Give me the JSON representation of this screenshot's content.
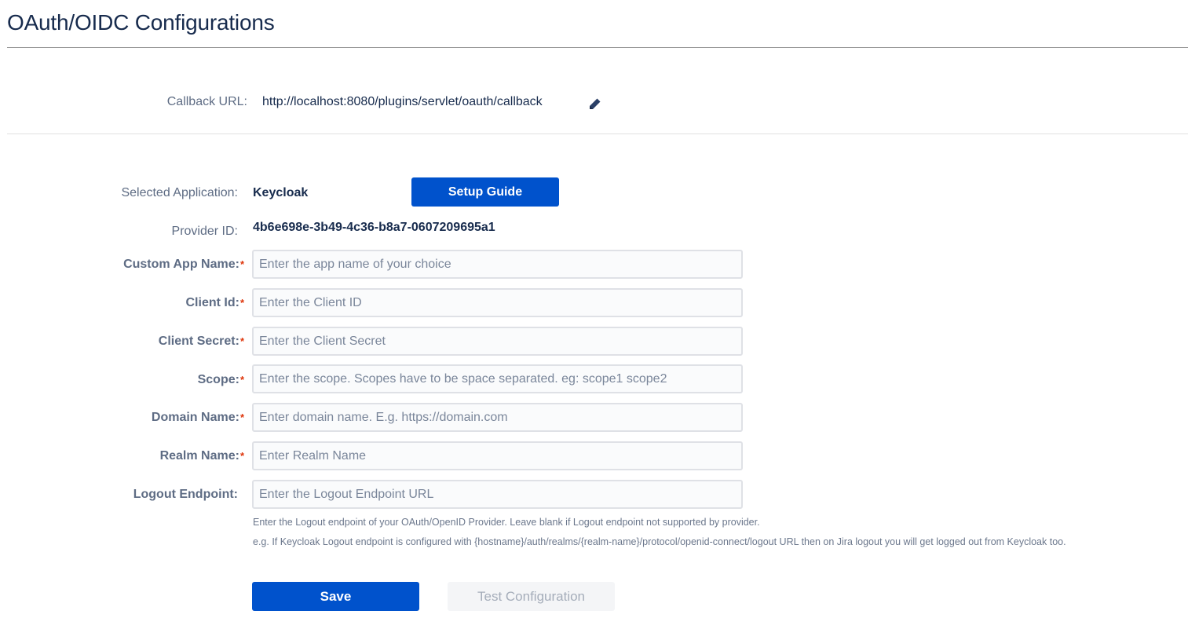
{
  "header": {
    "title": "OAuth/OIDC Configurations"
  },
  "callback": {
    "label": "Callback URL:",
    "url": "http://localhost:8080/plugins/servlet/oauth/callback",
    "edit_icon": "pencil-icon"
  },
  "application": {
    "selected_label": "Selected Application:",
    "selected_value": "Keycloak",
    "setup_guide_label": "Setup Guide",
    "provider_label": "Provider ID:",
    "provider_value": "4b6e698e-3b49-4c36-b8a7-0607209695a1"
  },
  "form": {
    "required_marker": "*",
    "fields": [
      {
        "label": "Custom App Name:",
        "required": true,
        "value": "",
        "placeholder": "Enter the app name of your choice"
      },
      {
        "label": "Client Id:",
        "required": true,
        "value": "",
        "placeholder": "Enter the Client ID"
      },
      {
        "label": "Client Secret:",
        "required": true,
        "value": "",
        "placeholder": "Enter the Client Secret"
      },
      {
        "label": "Scope:",
        "required": true,
        "value": "",
        "placeholder": "Enter the scope. Scopes have to be space separated. eg: scope1 scope2"
      },
      {
        "label": "Domain Name:",
        "required": true,
        "value": "",
        "placeholder": "Enter domain name. E.g. https://domain.com"
      },
      {
        "label": "Realm Name:",
        "required": true,
        "value": "",
        "placeholder": "Enter Realm Name"
      },
      {
        "label": "Logout Endpoint:",
        "required": false,
        "value": "",
        "placeholder": "Enter the Logout Endpoint URL"
      }
    ],
    "logout_help": [
      "Enter the Logout endpoint of your OAuth/OpenID Provider. Leave blank if Logout endpoint not supported by provider.",
      "e.g. If Keycloak Logout endpoint is configured with {hostname}/auth/realms/{realm-name}/protocol/openid-connect/logout URL then on Jira logout you will get logged out from Keycloak too."
    ]
  },
  "actions": {
    "save_label": "Save",
    "test_label": "Test Configuration",
    "test_disabled": true
  },
  "colors": {
    "primary": "#0052CC",
    "required": "#DE350B",
    "text": "#172B4D",
    "label": "#5E6C84"
  }
}
